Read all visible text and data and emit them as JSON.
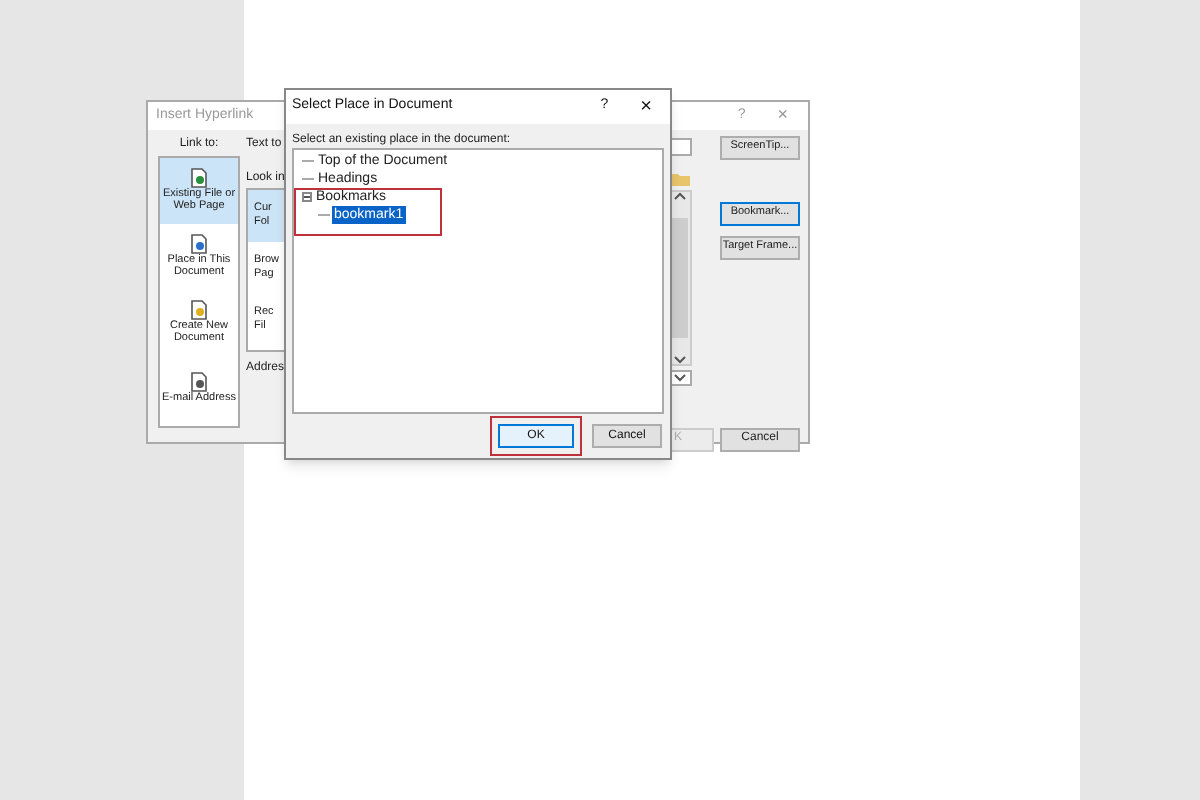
{
  "insert_hyperlink_dialog": {
    "title": "Insert Hyperlink",
    "help": "?",
    "close": "×",
    "link_to_label": "Link to:",
    "link_to": [
      {
        "kind": "web",
        "label": "Existing File or Web Page",
        "selected": true
      },
      {
        "kind": "place",
        "label": "Place in This Document",
        "selected": false
      },
      {
        "kind": "new",
        "label": "Create New Document",
        "selected": false
      },
      {
        "kind": "mail",
        "label": "E-mail Address",
        "selected": false
      }
    ],
    "text_to_label": "Text to",
    "look_in_label": "Look in",
    "browse_items": [
      {
        "lines": [
          "Cur",
          "Fol"
        ],
        "selected": true
      },
      {
        "lines": [
          "Brow",
          "Pag"
        ],
        "selected": false
      },
      {
        "lines": [
          "Rec",
          "Fil"
        ],
        "selected": false
      }
    ],
    "address_label": "Addres",
    "side_buttons": [
      {
        "label": "ScreenTip...",
        "focused": false
      },
      {
        "label": "Bookmark...",
        "focused": true
      },
      {
        "label": "Target Frame...",
        "focused": false
      }
    ],
    "ok_button": {
      "label": "K",
      "disabled": true
    },
    "cancel_button": "Cancel"
  },
  "select_place_dialog": {
    "title": "Select Place in Document",
    "help": "?",
    "close": "×",
    "prompt": "Select an existing place in the document:",
    "tree": [
      {
        "label": "Top of the Document",
        "selected": false,
        "expanded": false
      },
      {
        "label": "Headings",
        "selected": false,
        "expanded": false
      },
      {
        "label": "Bookmarks",
        "selected": false,
        "expanded": true,
        "children": [
          {
            "label": "bookmark1",
            "selected": true,
            "expanded": false
          }
        ]
      }
    ],
    "ok_button": "OK",
    "cancel_button": "Cancel"
  }
}
